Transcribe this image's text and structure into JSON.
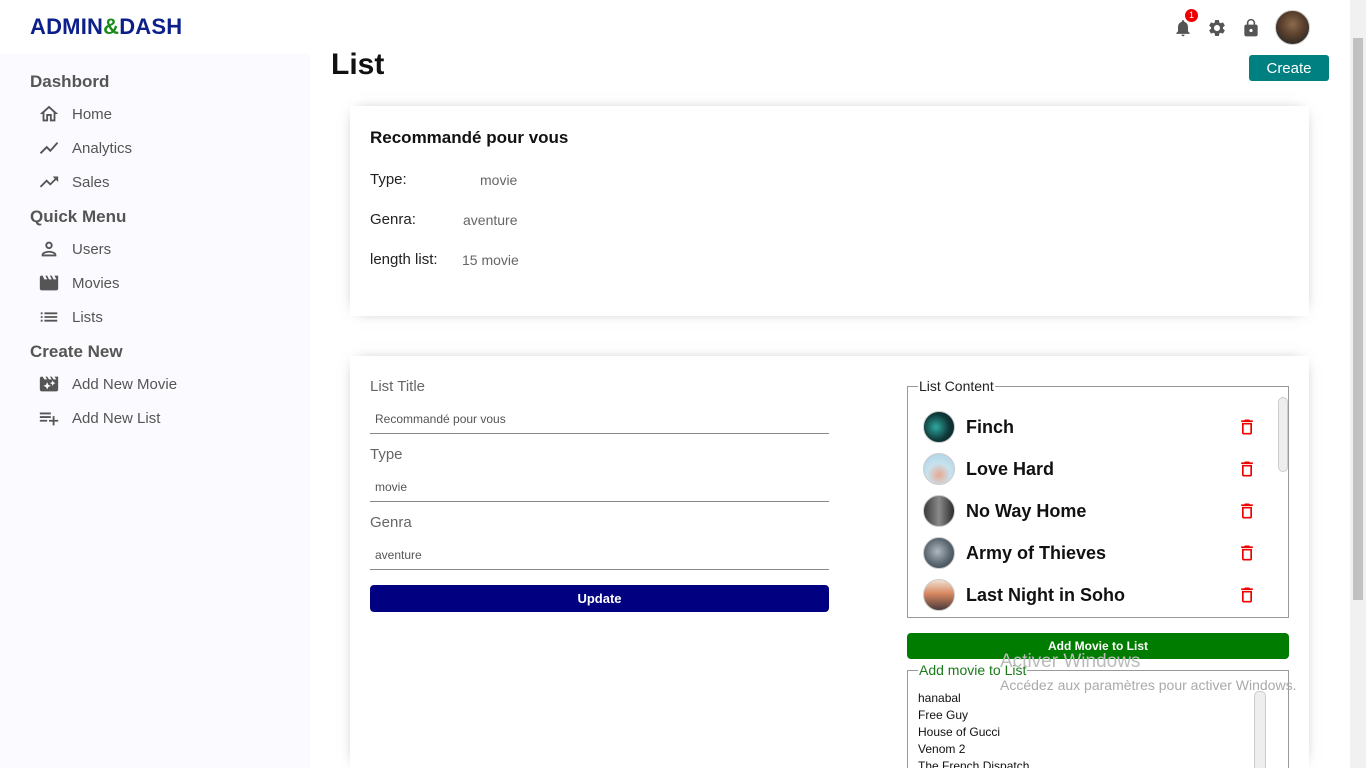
{
  "app": {
    "logo_part1": "ADMIN",
    "logo_amp": "&",
    "logo_part2": "DASH"
  },
  "header": {
    "notification_count": "1",
    "icons": [
      "notification-icon",
      "settings-icon",
      "lock-icon"
    ]
  },
  "sidebar": {
    "sections": [
      {
        "title": "Dashbord",
        "items": [
          {
            "label": "Home",
            "icon": "home-icon"
          },
          {
            "label": "Analytics",
            "icon": "analytics-icon"
          },
          {
            "label": "Sales",
            "icon": "trending-up-icon"
          }
        ]
      },
      {
        "title": "Quick Menu",
        "items": [
          {
            "label": "Users",
            "icon": "user-icon"
          },
          {
            "label": "Movies",
            "icon": "movie-icon"
          },
          {
            "label": "Lists",
            "icon": "list-icon"
          }
        ]
      },
      {
        "title": "Create New",
        "items": [
          {
            "label": "Add New Movie",
            "icon": "add-movie-icon"
          },
          {
            "label": "Add New List",
            "icon": "playlist-add-icon"
          }
        ]
      }
    ]
  },
  "main": {
    "title": "List",
    "create_label": "Create",
    "info": {
      "title": "Recommandé pour vous",
      "rows": [
        {
          "key": "Type:",
          "value": "movie"
        },
        {
          "key": "Genra:",
          "value": "aventure"
        },
        {
          "key": "length list:",
          "value": "15 movie"
        }
      ]
    },
    "form": {
      "fields": [
        {
          "label": "List Title",
          "value": "Recommandé pour vous"
        },
        {
          "label": "Type",
          "value": "movie"
        },
        {
          "label": "Genra",
          "value": "aventure"
        }
      ],
      "update_label": "Update"
    },
    "list_content": {
      "legend": "List Content",
      "movies": [
        {
          "title": "Finch",
          "thumb": "#1a4a4a"
        },
        {
          "title": "Love Hard",
          "thumb": "#a8d4e6"
        },
        {
          "title": "No Way Home",
          "thumb": "#5a5a5a"
        },
        {
          "title": "Army of Thieves",
          "thumb": "#6a7a8a"
        },
        {
          "title": "Last Night in Soho",
          "thumb": "#c87a5a"
        }
      ]
    },
    "add_movie_label": "Add Movie to List",
    "add_movie_box": {
      "legend": "Add movie to List",
      "options": [
        "hanabal",
        "Free Guy",
        "House of Gucci",
        "Venom 2",
        "The French Dispatch"
      ]
    }
  },
  "watermark": {
    "line1": "Activer Windows",
    "line2": "Accédez aux paramètres pour activer Windows."
  },
  "colors": {
    "logo_blue": "#0d1f8a",
    "logo_green": "#1a8a1a",
    "create_button": "#008080",
    "update_button": "#000080",
    "add_button": "#007d00",
    "delete_icon": "#ee0000"
  }
}
